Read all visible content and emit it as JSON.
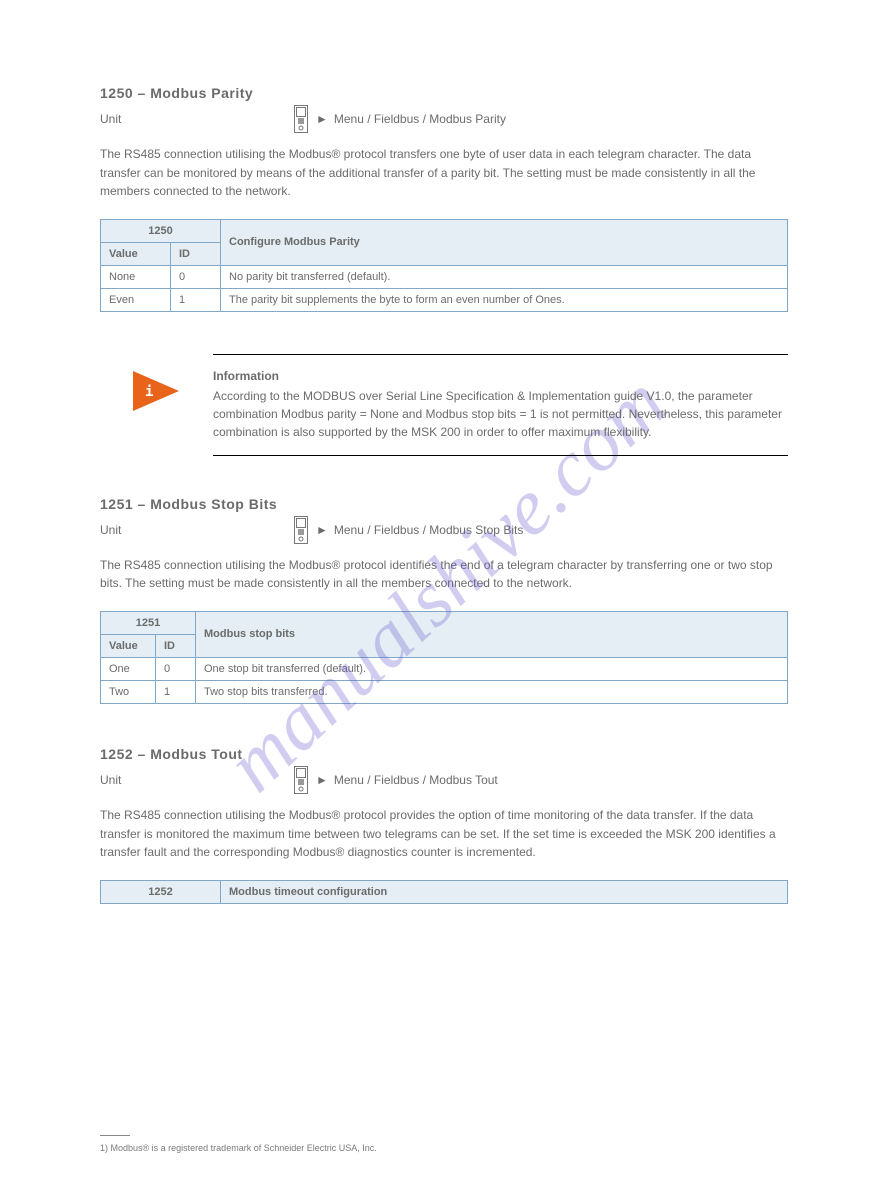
{
  "watermark": "manualshive.com",
  "footer_note": "1) Modbus® is a registered trademark of Schneider Electric USA, Inc.",
  "sections": [
    {
      "id": "s1",
      "title": "1250 – Modbus Parity",
      "nav_label": "Unit",
      "nav_path": "Menu / Fieldbus / Modbus Parity",
      "body": "The RS485 connection utilising the Modbus® protocol transfers one byte of user data in each telegram character. The data transfer can be monitored by means of the additional transfer of a parity bit. The setting must be made consistently in all the members connected to the network.",
      "table": {
        "head_col1": "1250",
        "head_col2": "Configure Modbus Parity",
        "sub1": "Value",
        "sub2": "ID",
        "rows": [
          {
            "v": "None",
            "i": "0",
            "d": "No parity bit transferred (default)."
          },
          {
            "v": "Even",
            "i": "1",
            "d": "The parity bit supplements the byte to form an even number of Ones."
          }
        ]
      }
    },
    {
      "id": "s2",
      "title": "1251 – Modbus Stop Bits",
      "nav_label": "Unit",
      "nav_path": "Menu / Fieldbus / Modbus Stop Bits",
      "body": "The RS485 connection utilising the Modbus® protocol identifies the end of a telegram character by transferring one or two stop bits. The setting must be made consistently in all the members connected to the network.",
      "table": {
        "head_col1": "1251",
        "head_col2": "Modbus stop bits",
        "sub1": "Value",
        "sub2": "ID",
        "rows": [
          {
            "v": "One",
            "i": "0",
            "d": "One stop bit transferred (default)."
          },
          {
            "v": "Two",
            "i": "1",
            "d": "Two stop bits transferred."
          }
        ]
      }
    },
    {
      "id": "s3",
      "title": "1252 – Modbus Tout",
      "nav_label": "Unit",
      "nav_path": "Menu / Fieldbus / Modbus Tout",
      "body": "The RS485 connection utilising the Modbus® protocol provides the option of time monitoring of the data transfer. If the data transfer is monitored the maximum time between two telegrams can be set. If the set time is exceeded the MSK 200 identifies a transfer fault and the corresponding Modbus® diagnostics counter is incremented.",
      "table": {
        "head_col1": "1252",
        "head_col2": "Modbus timeout configuration"
      }
    }
  ],
  "info": {
    "title": "Information",
    "body": "According to the MODBUS over Serial Line Specification & Implementation guide V1.0, the parameter combination Modbus parity = None and Modbus stop bits = 1 is not permitted. Nevertheless, this parameter combination is also supported by the MSK 200 in order to offer maximum flexibility."
  }
}
